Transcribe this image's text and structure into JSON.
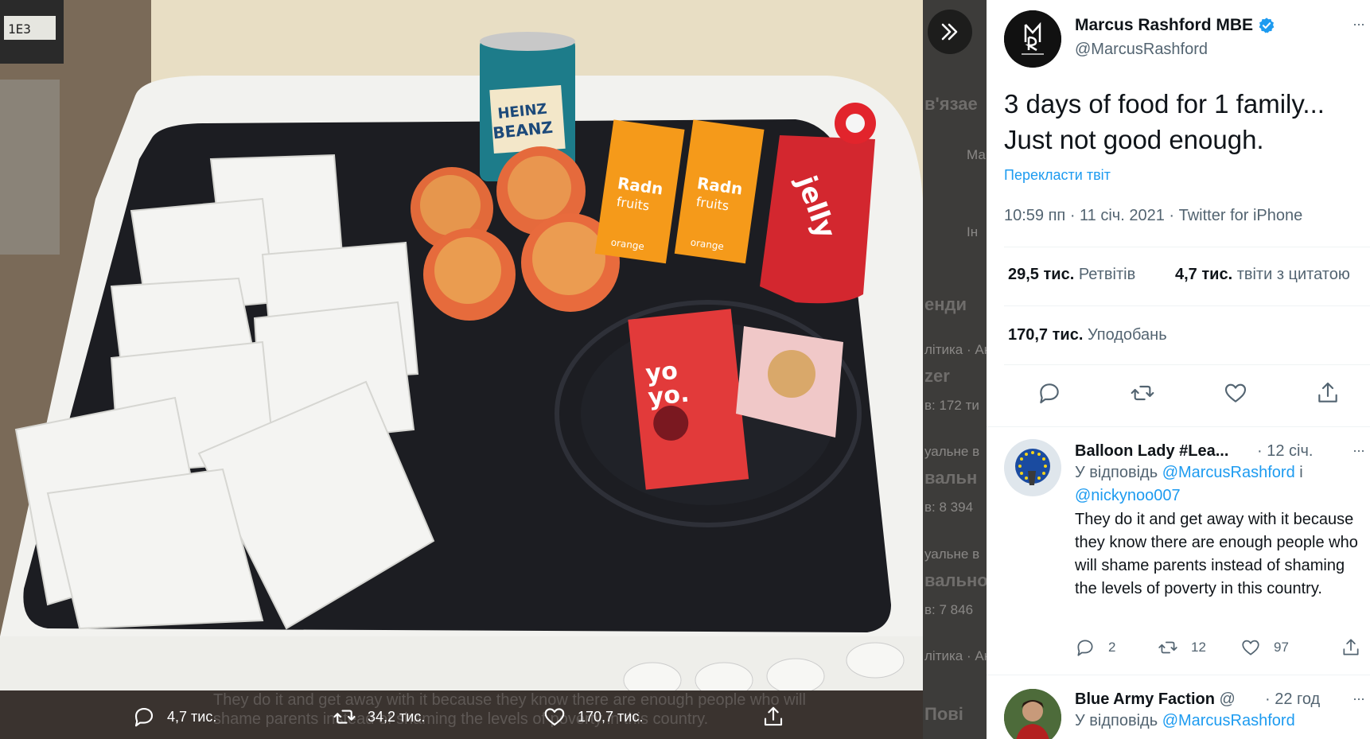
{
  "media": {
    "actions": {
      "replies": "4,7 тис.",
      "retweets": "34,2 тис.",
      "likes": "170,7 тис."
    },
    "underlay_text": "They do it and get away with it because they know there are enough people who will shame parents instead of shaming the levels of poverty in this country.",
    "underlay_sidebar": [
      "в'язае",
      "Ма",
      "Ін",
      "енди",
      "літика · Ак",
      "zer",
      "в: 172 ти",
      "уальне в",
      "вальн",
      "в: 8 394",
      "уальне в",
      "вальної",
      "в: 7 846",
      "літика · Ак",
      "Пові"
    ]
  },
  "tweet": {
    "author_name": "Marcus Rashford MBE",
    "handle": "@MarcusRashford",
    "text_line1": "3 days of food for 1 family...",
    "text_line2": "Just not good enough.",
    "translate": "Перекласти твіт",
    "timestamp": "10:59 пп · 11 січ. 2021",
    "source": "Twitter for iPhone",
    "retweets_count": "29,5 тис.",
    "retweets_label": "Ретвітів",
    "quotes_count": "4,7 тис.",
    "quotes_label": "твіти з цитатою",
    "likes_count": "170,7 тис.",
    "likes_label": "Уподобань",
    "more": "···"
  },
  "replies": [
    {
      "name": "Balloon Lady #Lea...",
      "time": "· 12 січ.",
      "replying_prefix": "У відповідь",
      "replying_to_1": "@MarcusRashford",
      "replying_conj": "і",
      "replying_to_2": "@nickynoo007",
      "body": "They do it and get away with it because they know there are enough people who will shame parents instead of shaming the levels of poverty in this country.",
      "replies": "2",
      "retweets": "12",
      "likes": "97"
    },
    {
      "name": "Blue Army Faction",
      "handle_start": "@",
      "time": "· 22 год",
      "replying_prefix": "У відповідь",
      "replying_to_1": "@MarcusRashford"
    }
  ],
  "colors": {
    "link": "#1d9bf0",
    "verified": "#1d9bf0",
    "muted": "#536471"
  }
}
